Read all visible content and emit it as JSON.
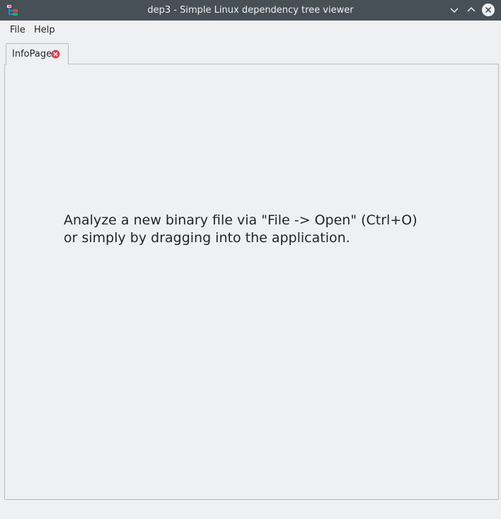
{
  "window": {
    "title": "dep3 - Simple Linux dependency tree viewer",
    "icon": "app-tree-icon",
    "buttons": [
      "minimize-icon",
      "maximize-icon",
      "close-icon"
    ]
  },
  "menubar": {
    "items": [
      {
        "label": "File"
      },
      {
        "label": "Help"
      }
    ]
  },
  "tabs": [
    {
      "label": "InfoPage",
      "close_icon": "tab-close-icon",
      "active": true
    }
  ],
  "info": {
    "line1": "Analyze a new binary file via \"File -> Open\" (Ctrl+O)",
    "line2": "or simply by dragging into the application."
  },
  "colors": {
    "titlebar": "#475057",
    "background": "#eff0f1",
    "text": "#232627",
    "tab_close": "#da4453"
  }
}
